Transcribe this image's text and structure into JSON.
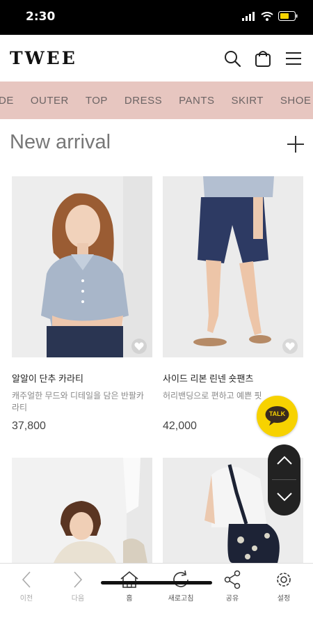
{
  "status_bar": {
    "time": "2:30"
  },
  "header": {
    "logo": "TWEE"
  },
  "categories": [
    "DE",
    "OUTER",
    "TOP",
    "DRESS",
    "PANTS",
    "SKIRT",
    "SHOE"
  ],
  "section": {
    "title": "New arrival"
  },
  "products": [
    {
      "name": "알알이 단추 카라티",
      "description": "캐주얼한 무드와 디테일을 담은 반팔카라티",
      "price": "37,800"
    },
    {
      "name": "사이드 리본 린넨 숏팬츠",
      "description": "허리밴딩으로 편하고 예쁜 핏",
      "price": "42,000"
    }
  ],
  "chat_button": {
    "label": "TALK"
  },
  "bottom_nav": [
    {
      "label": "이전",
      "icon": "back-arrow-icon"
    },
    {
      "label": "다음",
      "icon": "forward-arrow-icon"
    },
    {
      "label": "홈",
      "icon": "home-icon"
    },
    {
      "label": "새로고침",
      "icon": "refresh-icon"
    },
    {
      "label": "공유",
      "icon": "share-icon"
    },
    {
      "label": "설정",
      "icon": "settings-icon"
    }
  ],
  "colors": {
    "category_bar": "#e7c6c0",
    "chat_button": "#f7d200",
    "scroll_buttons": "#222222"
  }
}
